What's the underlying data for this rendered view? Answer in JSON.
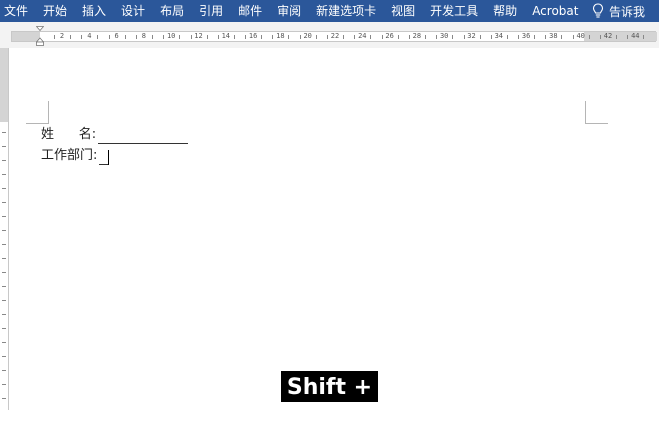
{
  "ribbon": {
    "tabs": [
      "文件",
      "开始",
      "插入",
      "设计",
      "布局",
      "引用",
      "邮件",
      "审阅",
      "新建选项卡",
      "视图",
      "开发工具",
      "帮助",
      "Acrobat"
    ],
    "tell_me": "告诉我"
  },
  "ruler": {
    "labels": [
      "2",
      "4",
      "6",
      "8",
      "10",
      "12",
      "14",
      "16",
      "18",
      "20",
      "22",
      "24",
      "26",
      "28",
      "30",
      "32",
      "34",
      "36",
      "38",
      "40",
      "42",
      "44"
    ]
  },
  "document": {
    "name_label": "姓      名:",
    "dept_label": "工作部门:"
  },
  "overlay": {
    "shortcut": "Shift + -"
  },
  "colors": {
    "ribbon": "#2b579a"
  }
}
